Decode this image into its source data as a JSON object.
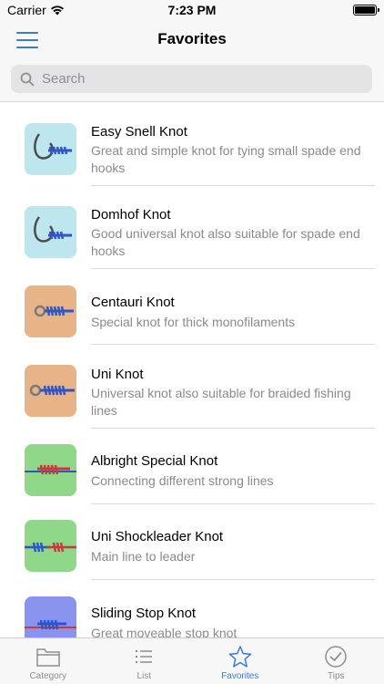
{
  "status_bar": {
    "carrier": "Carrier",
    "time": "7:23 PM"
  },
  "nav": {
    "title": "Favorites",
    "menu_icon": "hamburger-menu-icon"
  },
  "search": {
    "placeholder": "Search",
    "value": ""
  },
  "knots": [
    {
      "name": "Easy Snell Knot",
      "description": "Great and simple knot for tying small spade end hooks",
      "thumb_bg": "#bde6ee",
      "line_color": "#2f55c9",
      "kind": "hook"
    },
    {
      "name": "Domhof Knot",
      "description": "Good universal knot also suitable for spade end hooks",
      "thumb_bg": "#bde6ee",
      "line_color": "#2f55c9",
      "kind": "hook"
    },
    {
      "name": "Centauri Knot",
      "description": "Special knot for thick monofilaments",
      "thumb_bg": "#e8b487",
      "line_color": "#2f55c9",
      "kind": "ring"
    },
    {
      "name": "Uni Knot",
      "description": "Universal knot also suitable for braided fishing lines",
      "thumb_bg": "#e8b487",
      "line_color": "#2f55c9",
      "kind": "ring"
    },
    {
      "name": "Albright Special Knot",
      "description": "Connecting different strong lines",
      "thumb_bg": "#8fd88a",
      "line_color": "#c83a3a",
      "kind": "line"
    },
    {
      "name": "Uni Shockleader Knot",
      "description": "Main line to leader",
      "thumb_bg": "#8fd88a",
      "line_color": "#c83a3a",
      "kind": "line"
    },
    {
      "name": "Sliding Stop Knot",
      "description": "Great moveable stop knot",
      "thumb_bg": "#8a94ee",
      "line_color": "#c83a3a",
      "kind": "line"
    }
  ],
  "tabs": [
    {
      "label": "Category",
      "icon": "folder-icon",
      "active": false
    },
    {
      "label": "List",
      "icon": "list-icon",
      "active": false
    },
    {
      "label": "Favorites",
      "icon": "star-icon",
      "active": true
    },
    {
      "label": "Tips",
      "icon": "checkmark-circle-icon",
      "active": false
    }
  ],
  "colors": {
    "accent": "#3a7bd5",
    "secondary_text": "#8a8a8e",
    "bar_background": "#f7f7f7"
  }
}
